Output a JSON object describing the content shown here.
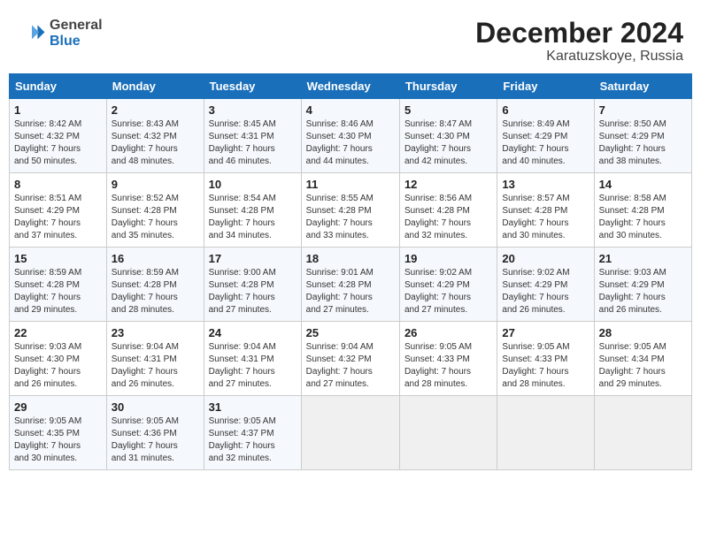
{
  "header": {
    "logo_line1": "General",
    "logo_line2": "Blue",
    "title": "December 2024",
    "subtitle": "Karatuzskoye, Russia"
  },
  "weekdays": [
    "Sunday",
    "Monday",
    "Tuesday",
    "Wednesday",
    "Thursday",
    "Friday",
    "Saturday"
  ],
  "weeks": [
    [
      {
        "day": "1",
        "sunrise": "8:42 AM",
        "sunset": "4:32 PM",
        "daylight": "7 hours and 50 minutes."
      },
      {
        "day": "2",
        "sunrise": "8:43 AM",
        "sunset": "4:32 PM",
        "daylight": "7 hours and 48 minutes."
      },
      {
        "day": "3",
        "sunrise": "8:45 AM",
        "sunset": "4:31 PM",
        "daylight": "7 hours and 46 minutes."
      },
      {
        "day": "4",
        "sunrise": "8:46 AM",
        "sunset": "4:30 PM",
        "daylight": "7 hours and 44 minutes."
      },
      {
        "day": "5",
        "sunrise": "8:47 AM",
        "sunset": "4:30 PM",
        "daylight": "7 hours and 42 minutes."
      },
      {
        "day": "6",
        "sunrise": "8:49 AM",
        "sunset": "4:29 PM",
        "daylight": "7 hours and 40 minutes."
      },
      {
        "day": "7",
        "sunrise": "8:50 AM",
        "sunset": "4:29 PM",
        "daylight": "7 hours and 38 minutes."
      }
    ],
    [
      {
        "day": "8",
        "sunrise": "8:51 AM",
        "sunset": "4:29 PM",
        "daylight": "7 hours and 37 minutes."
      },
      {
        "day": "9",
        "sunrise": "8:52 AM",
        "sunset": "4:28 PM",
        "daylight": "7 hours and 35 minutes."
      },
      {
        "day": "10",
        "sunrise": "8:54 AM",
        "sunset": "4:28 PM",
        "daylight": "7 hours and 34 minutes."
      },
      {
        "day": "11",
        "sunrise": "8:55 AM",
        "sunset": "4:28 PM",
        "daylight": "7 hours and 33 minutes."
      },
      {
        "day": "12",
        "sunrise": "8:56 AM",
        "sunset": "4:28 PM",
        "daylight": "7 hours and 32 minutes."
      },
      {
        "day": "13",
        "sunrise": "8:57 AM",
        "sunset": "4:28 PM",
        "daylight": "7 hours and 30 minutes."
      },
      {
        "day": "14",
        "sunrise": "8:58 AM",
        "sunset": "4:28 PM",
        "daylight": "7 hours and 30 minutes."
      }
    ],
    [
      {
        "day": "15",
        "sunrise": "8:59 AM",
        "sunset": "4:28 PM",
        "daylight": "7 hours and 29 minutes."
      },
      {
        "day": "16",
        "sunrise": "8:59 AM",
        "sunset": "4:28 PM",
        "daylight": "7 hours and 28 minutes."
      },
      {
        "day": "17",
        "sunrise": "9:00 AM",
        "sunset": "4:28 PM",
        "daylight": "7 hours and 27 minutes."
      },
      {
        "day": "18",
        "sunrise": "9:01 AM",
        "sunset": "4:28 PM",
        "daylight": "7 hours and 27 minutes."
      },
      {
        "day": "19",
        "sunrise": "9:02 AM",
        "sunset": "4:29 PM",
        "daylight": "7 hours and 27 minutes."
      },
      {
        "day": "20",
        "sunrise": "9:02 AM",
        "sunset": "4:29 PM",
        "daylight": "7 hours and 26 minutes."
      },
      {
        "day": "21",
        "sunrise": "9:03 AM",
        "sunset": "4:29 PM",
        "daylight": "7 hours and 26 minutes."
      }
    ],
    [
      {
        "day": "22",
        "sunrise": "9:03 AM",
        "sunset": "4:30 PM",
        "daylight": "7 hours and 26 minutes."
      },
      {
        "day": "23",
        "sunrise": "9:04 AM",
        "sunset": "4:31 PM",
        "daylight": "7 hours and 26 minutes."
      },
      {
        "day": "24",
        "sunrise": "9:04 AM",
        "sunset": "4:31 PM",
        "daylight": "7 hours and 27 minutes."
      },
      {
        "day": "25",
        "sunrise": "9:04 AM",
        "sunset": "4:32 PM",
        "daylight": "7 hours and 27 minutes."
      },
      {
        "day": "26",
        "sunrise": "9:05 AM",
        "sunset": "4:33 PM",
        "daylight": "7 hours and 28 minutes."
      },
      {
        "day": "27",
        "sunrise": "9:05 AM",
        "sunset": "4:33 PM",
        "daylight": "7 hours and 28 minutes."
      },
      {
        "day": "28",
        "sunrise": "9:05 AM",
        "sunset": "4:34 PM",
        "daylight": "7 hours and 29 minutes."
      }
    ],
    [
      {
        "day": "29",
        "sunrise": "9:05 AM",
        "sunset": "4:35 PM",
        "daylight": "7 hours and 30 minutes."
      },
      {
        "day": "30",
        "sunrise": "9:05 AM",
        "sunset": "4:36 PM",
        "daylight": "7 hours and 31 minutes."
      },
      {
        "day": "31",
        "sunrise": "9:05 AM",
        "sunset": "4:37 PM",
        "daylight": "7 hours and 32 minutes."
      },
      null,
      null,
      null,
      null
    ]
  ]
}
